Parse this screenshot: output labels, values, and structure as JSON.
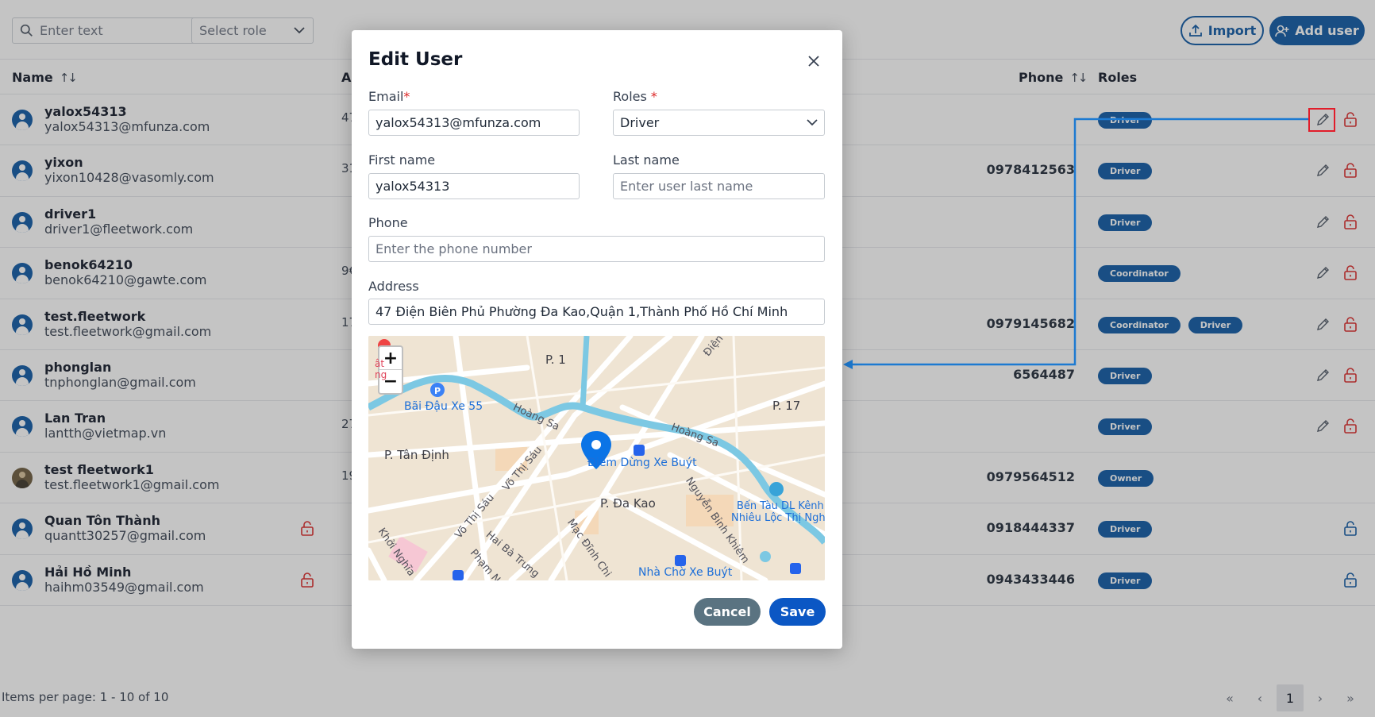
{
  "toolbar": {
    "search_placeholder": "Enter text",
    "role_select": "Select role",
    "import_label": "Import",
    "add_user_label": "Add user"
  },
  "table": {
    "headers": {
      "name": "Name",
      "address_cut": "A",
      "phone": "Phone",
      "roles": "Roles"
    },
    "rows": [
      {
        "name": "yalox54313",
        "email": "yalox54313@mfunza.com",
        "address_cut": "47",
        "phone": "",
        "roles": [
          "Driver"
        ]
      },
      {
        "name": "yixon",
        "email": "yixon10428@vasomly.com",
        "address_cut": "31",
        "phone": "0978412563",
        "roles": [
          "Driver"
        ]
      },
      {
        "name": "driver1",
        "email": "driver1@fleetwork.com",
        "address_cut": "",
        "phone": "",
        "roles": [
          "Driver"
        ]
      },
      {
        "name": "benok64210",
        "email": "benok64210@gawte.com",
        "address_cut": "9€",
        "phone": "",
        "roles": [
          "Coordinator"
        ]
      },
      {
        "name": "test.fleetwork",
        "email": "test.fleetwork@gmail.com",
        "address_cut": "17",
        "phone": "0979145682",
        "roles": [
          "Coordinator",
          "Driver"
        ]
      },
      {
        "name": "phonglan",
        "email": "tnphonglan@gmail.com",
        "address_cut": "",
        "phone": "6564487",
        "roles": [
          "Driver"
        ]
      },
      {
        "name": "Lan Tran",
        "email": "lantth@vietmap.vn",
        "address_cut": "27",
        "phone": "",
        "roles": [
          "Driver"
        ]
      },
      {
        "name": "test fleetwork1",
        "email": "test.fleetwork1@gmail.com",
        "address_cut": "19",
        "phone": "0979564512",
        "roles": [
          "Owner"
        ]
      },
      {
        "name": "Quan Tôn Thành",
        "email": "quantt30257@gmail.com",
        "address_cut": "",
        "phone": "0918444337",
        "roles": [
          "Driver"
        ]
      },
      {
        "name": "Hải Hồ Minh",
        "email": "haihm03549@gmail.com",
        "address_cut": "",
        "phone": "0943433446",
        "roles": [
          "Driver"
        ]
      }
    ]
  },
  "footer": {
    "items_per_page": "Items per page: 1 - 10 of 10",
    "current_page": "1",
    "pager": {
      "first": "«",
      "prev": "‹",
      "next": "›",
      "last": "»"
    }
  },
  "modal": {
    "title": "Edit User",
    "email_label": "Email",
    "email_value": "yalox54313@mfunza.com",
    "roles_label": "Roles ",
    "roles_value": "Driver",
    "first_name_label": "First name",
    "first_name_value": "yalox54313",
    "last_name_label": "Last name",
    "last_name_placeholder": "Enter user last name",
    "phone_label": "Phone",
    "phone_placeholder": "Enter the phone number",
    "address_label": "Address",
    "address_value": "47 Điện Biên Phủ Phường Đa Kao,Quận 1,Thành Phố Hồ Chí Minh",
    "required_mark": "*",
    "cancel_label": "Cancel",
    "save_label": "Save",
    "map": {
      "zoom_in": "+",
      "zoom_out": "−",
      "labels": {
        "p1": "P. 1",
        "p17": "P. 17",
        "p_tan_dinh": "P. Tân Định",
        "p_da_kao": "P. Đa Kao",
        "bai_dau": "Bãi Đậu Xe 55",
        "diem_dung": "Điểm Dừng Xe Buýt",
        "ben_tau_1": "Bến Tàu DL Kênh",
        "ben_tau_2": "Nhiêu Lộc Thị Nghè",
        "nha_cho": "Nhà Chờ Xe Buýt",
        "hoang_sa_1": "Hoàng Sa",
        "hoang_sa_2": "Hoàng Sa",
        "vo_thi_sau_1": "Võ Thị Sáu",
        "vo_thi_sau_2": "Võ Thị Sáu",
        "hai_ba_trung": "Hai Bà Trưng",
        "mac_dinh_chi": "Mạc Đĩnh Chi",
        "nguyen_binh_khiem": "Nguyễn Bỉnh Khiêm",
        "khoi_nghia": "Khởi Nghĩa",
        "pham_ng": "Phạm Ng",
        "dien": "Điện",
        "cut_top": "ât",
        "cut_mid": "ng"
      }
    }
  }
}
